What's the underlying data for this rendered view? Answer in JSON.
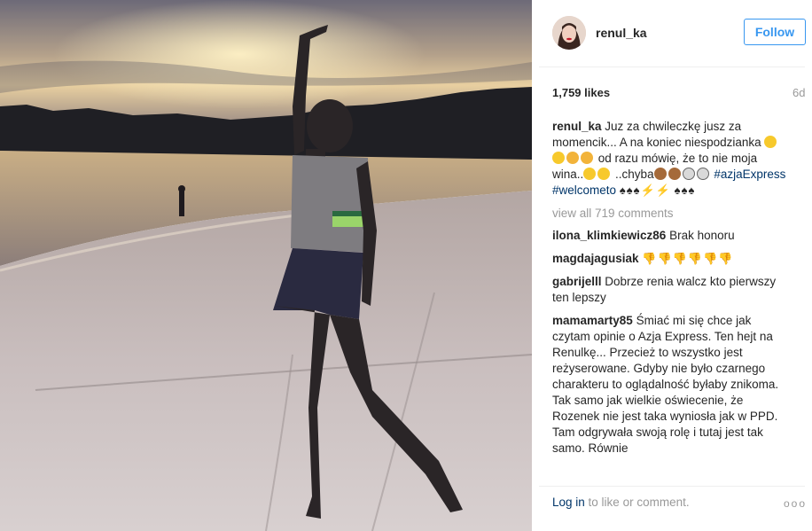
{
  "post": {
    "username": "renul_ka",
    "follow_label": "Follow",
    "likes": "1,759 likes",
    "time": "6d"
  },
  "caption": {
    "user": "renul_ka",
    "text_1": "Juz za chwileczkę jusz za momencik... A na koniec niespodzianka",
    "text_2": "od razu mówię, że to nie moja wina..",
    "text_3": "..chyba",
    "tag_1": "#azjaExpress",
    "tag_2": "#welcometo"
  },
  "view_all": "view all 719 comments",
  "comments": [
    {
      "user": "ilona_klimkiewicz86",
      "text": "Brak honoru"
    },
    {
      "user": "magdajagusiak",
      "text": ""
    },
    {
      "user": "gabrijelll",
      "text": "Dobrze renia walcz kto pierwszy ten lepszy"
    },
    {
      "user": "mamamarty85",
      "text": "Śmiać  mi się  chce  jak czytam  opinie  o Azja Express. Ten hejt na Renulkę... Przecież  to wszystko  jest reżyserowane. Gdyby  nie  było czarnego charakteru  to oglądalność  byłaby znikoma. Tak samo  jak wielkie  oświecenie, że  Rozenek nie  jest taka wyniosła jak w PPD. Tam odgrywała swoją  rolę i tutaj jest tak samo. Równie"
    }
  ],
  "footer": {
    "login": "Log in",
    "rest": " to like or comment.",
    "more": "ooo"
  },
  "icons": {
    "grinning": "grinning-face-icon",
    "monkey": "see-no-evil-monkey-icon",
    "skull": "skull-icon",
    "spade": "spade-icon",
    "bolt": "lightning-icon",
    "thumbs_down": "thumbs-down-icon"
  },
  "colors": {
    "link": "#003569",
    "follow": "#3897f0",
    "muted": "#999999"
  }
}
